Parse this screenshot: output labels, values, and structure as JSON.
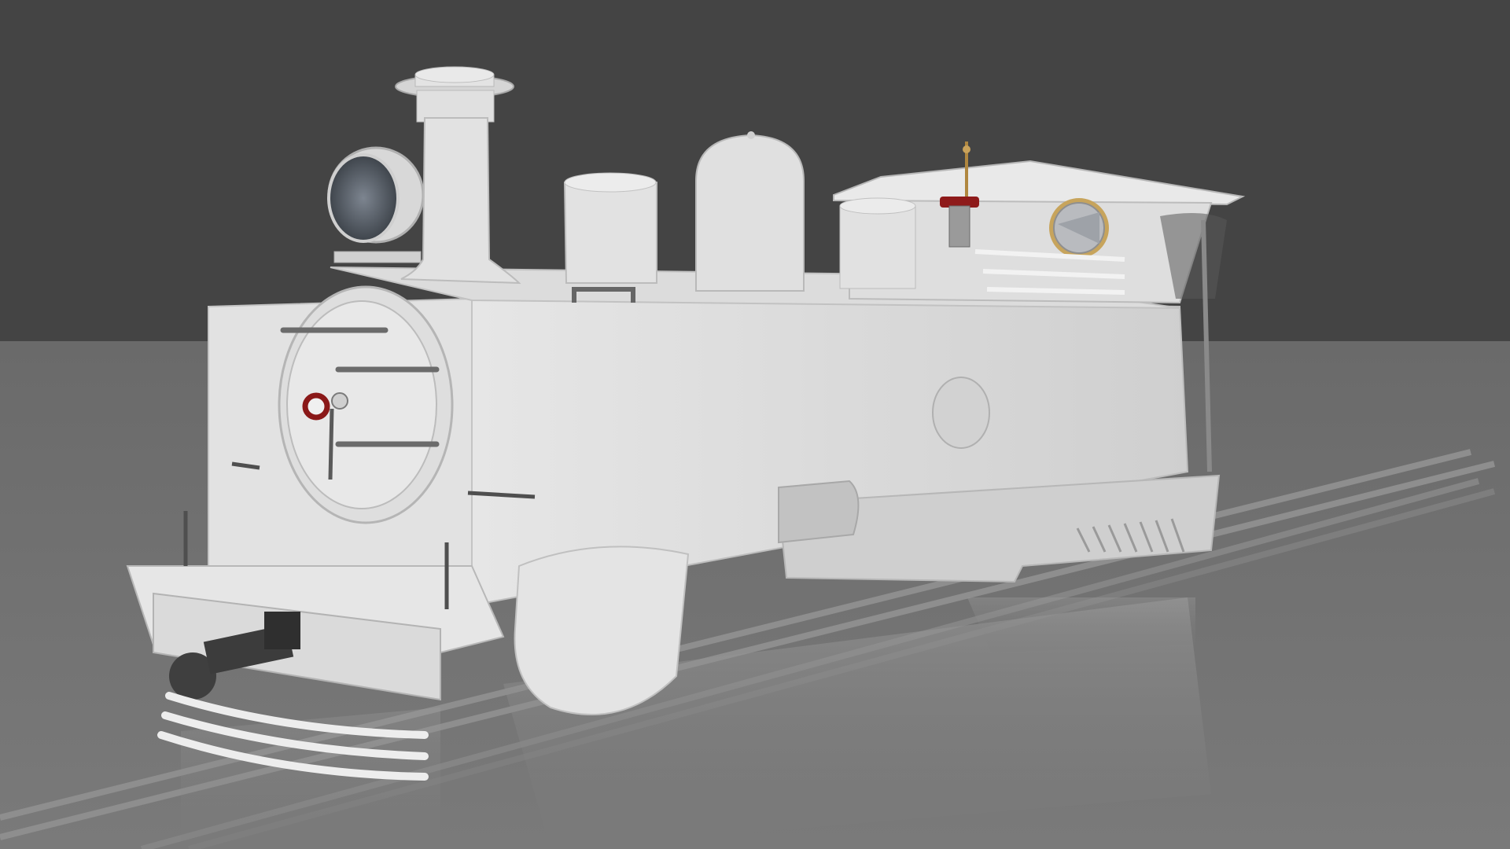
{
  "scene": {
    "subject": "steam-locomotive-render",
    "colors": {
      "backdrop": "#444444",
      "floor": "#6f6f6f",
      "body": "#d7d7d7",
      "shadow": "#a9a9a9",
      "metal": "#5a5a5a",
      "accent_red": "#9a1b1b",
      "brass": "#c9a25a"
    }
  }
}
